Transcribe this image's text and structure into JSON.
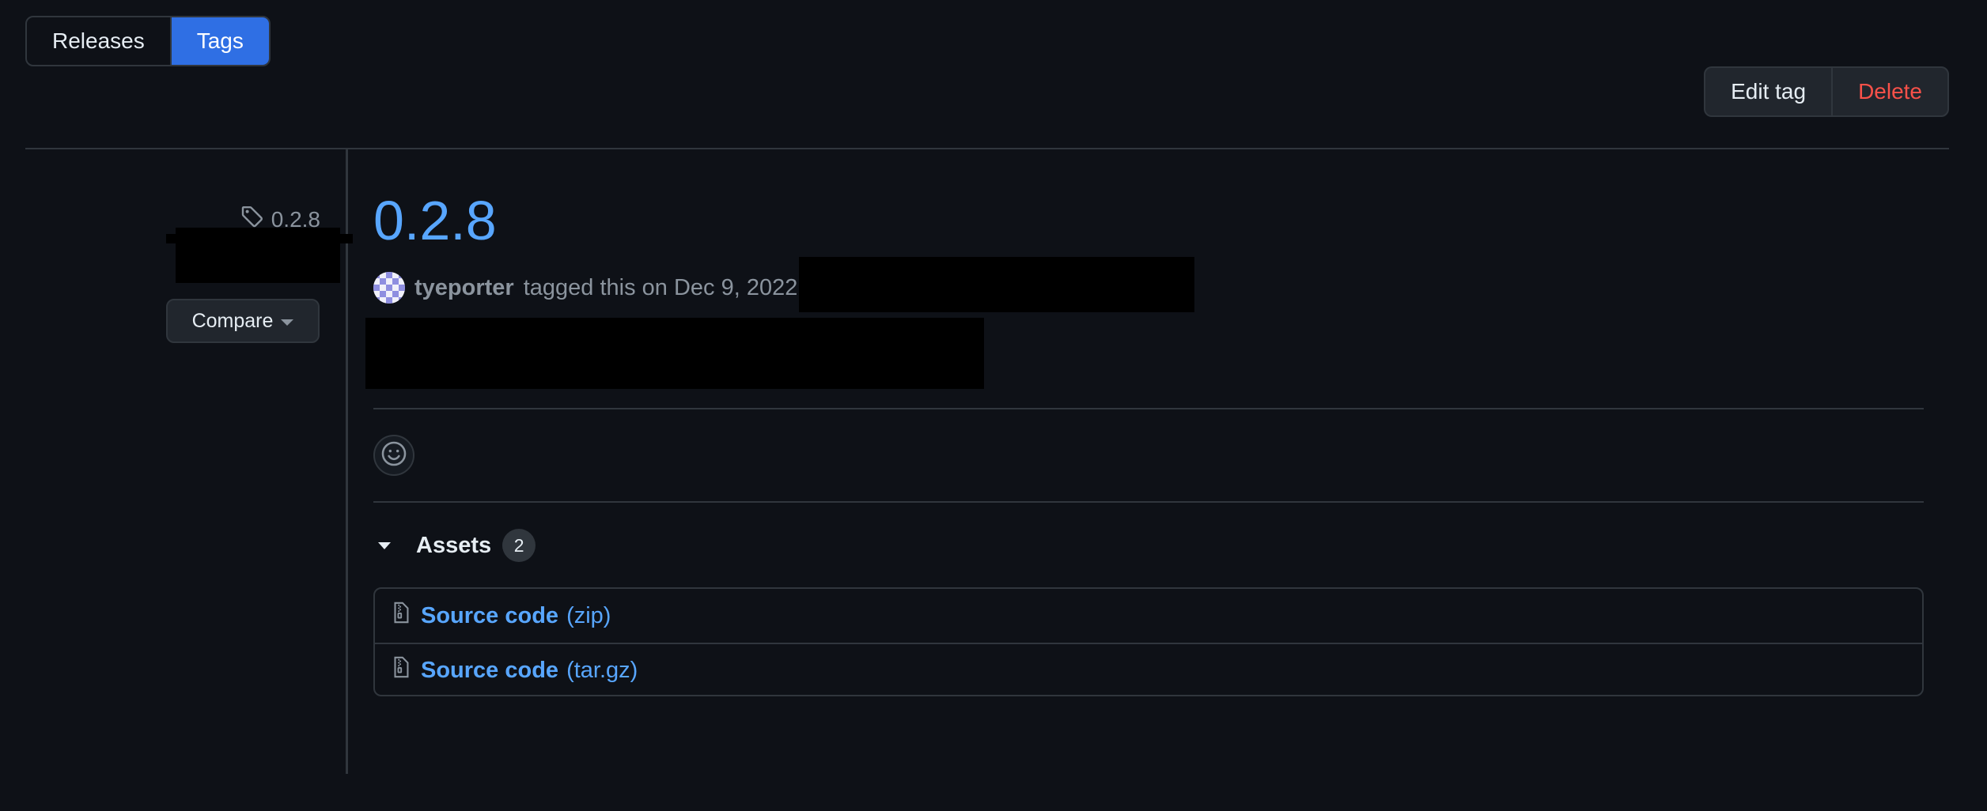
{
  "tabs": [
    {
      "label": "Releases",
      "active": false
    },
    {
      "label": "Tags",
      "active": true
    }
  ],
  "actions": {
    "edit_label": "Edit tag",
    "delete_label": "Delete"
  },
  "sidebar": {
    "tag_name": "0.2.8",
    "compare_label": "Compare"
  },
  "release": {
    "title": "0.2.8",
    "author": "tyeporter",
    "tagged_text": "tagged this on Dec 9, 2022"
  },
  "assets": {
    "heading": "Assets",
    "count": "2",
    "items": [
      {
        "name": "Source code",
        "ext": "(zip)"
      },
      {
        "name": "Source code",
        "ext": "(tar.gz)"
      }
    ]
  },
  "colors": {
    "background": "#0e1117",
    "accent": "#2f6fe4",
    "link": "#58a6ff",
    "danger": "#f85149",
    "border": "#30363d"
  },
  "icons": [
    "tag-icon",
    "chevron-down-icon",
    "smiley-icon",
    "triangle-down-icon",
    "file-zip-icon"
  ]
}
